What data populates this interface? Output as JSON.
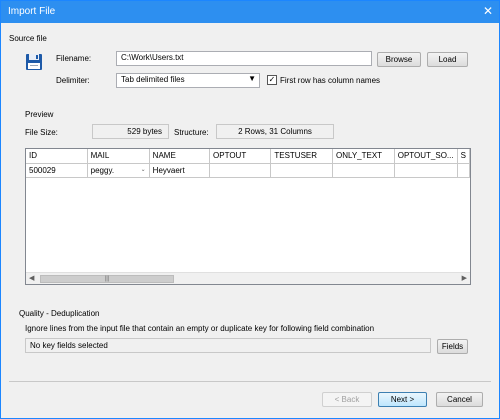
{
  "window": {
    "title": "Import File",
    "close_glyph": "✕"
  },
  "source_file": {
    "section_label": "Source file",
    "filename_label": "Filename:",
    "filename_value": "C:\\Work\\Users.txt",
    "browse_label": "Browse",
    "load_label": "Load",
    "delimiter_label": "Delimiter:",
    "delimiter_value": "Tab delimited files",
    "first_row_label": "First row has column names",
    "first_row_checked": true
  },
  "preview": {
    "section_label": "Preview",
    "file_size_label": "File Size:",
    "file_size_value": "529 bytes",
    "structure_label": "Structure:",
    "structure_value": "2 Rows, 31 Columns",
    "columns": [
      "ID",
      "MAIL",
      "NAME",
      "OPTOUT",
      "TESTUSER",
      "ONLY_TEXT",
      "OPTOUT_SO...",
      "S"
    ],
    "rows": [
      [
        "500029",
        "peggy.",
        "Heyvaert",
        "",
        "",
        "",
        "",
        ""
      ]
    ]
  },
  "quality": {
    "section_label": "Quality - Deduplication",
    "description": "Ignore lines from the input file that contain an empty or duplicate key for following field combination",
    "fields_value": "No key fields selected",
    "fields_button": "Fields"
  },
  "footer": {
    "back_label": "< Back",
    "next_label": "Next >",
    "cancel_label": "Cancel"
  },
  "colors": {
    "titlebar": "#2d8ff0",
    "accent": "#3c7fb1"
  },
  "icons": {
    "file": "floppy-disk-icon",
    "dropdown": "chevron-down-icon"
  }
}
